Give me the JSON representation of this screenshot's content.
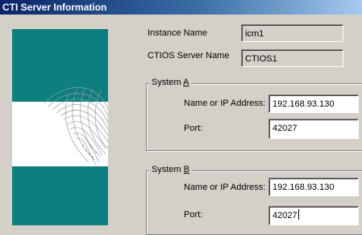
{
  "window": {
    "title": "CTI Server Information"
  },
  "instance": {
    "label": "Instance Name",
    "value": "icm1"
  },
  "ctios": {
    "label": "CTIOS Server Name",
    "value": "CTIOS1"
  },
  "system_a": {
    "legend_prefix": "System ",
    "legend_accel": "A",
    "address_label": "Name or IP Address:",
    "address_value": "192.168.93.130",
    "port_label": "Port:",
    "port_value": "42027"
  },
  "system_b": {
    "legend_prefix": "System ",
    "legend_accel": "B",
    "address_label": "Name or IP Address:",
    "address_value": "192.168.93.130",
    "port_label": "Port:",
    "port_value": "42027"
  },
  "colors": {
    "banner": "#0d7f7f",
    "titlebar": "#0a246a",
    "dialog": "#d4d0c8"
  }
}
